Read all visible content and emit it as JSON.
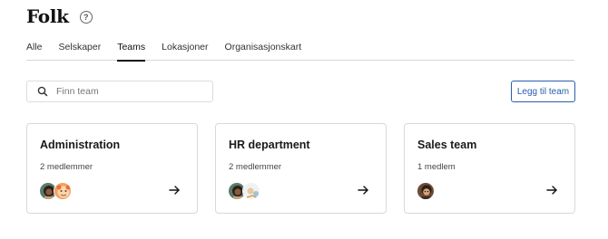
{
  "header": {
    "title": "Folk",
    "help_icon": "question-circle-icon"
  },
  "tabs": [
    {
      "label": "Alle",
      "active": false
    },
    {
      "label": "Selskaper",
      "active": false
    },
    {
      "label": "Teams",
      "active": true
    },
    {
      "label": "Lokasjoner",
      "active": false
    },
    {
      "label": "Organisasjonskart",
      "active": false
    }
  ],
  "search": {
    "placeholder": "Finn team",
    "value": "",
    "icon": "search-icon"
  },
  "actions": {
    "add_team_label": "Legg til team",
    "accent_color": "#2a5db0"
  },
  "teams": [
    {
      "name": "Administration",
      "member_count": "2 medlemmer",
      "avatars": [
        "avatar-1",
        "avatar-2"
      ]
    },
    {
      "name": "HR department",
      "member_count": "2 medlemmer",
      "avatars": [
        "avatar-1",
        "avatar-3"
      ]
    },
    {
      "name": "Sales team",
      "member_count": "1 medlem",
      "avatars": [
        "avatar-4"
      ]
    }
  ]
}
